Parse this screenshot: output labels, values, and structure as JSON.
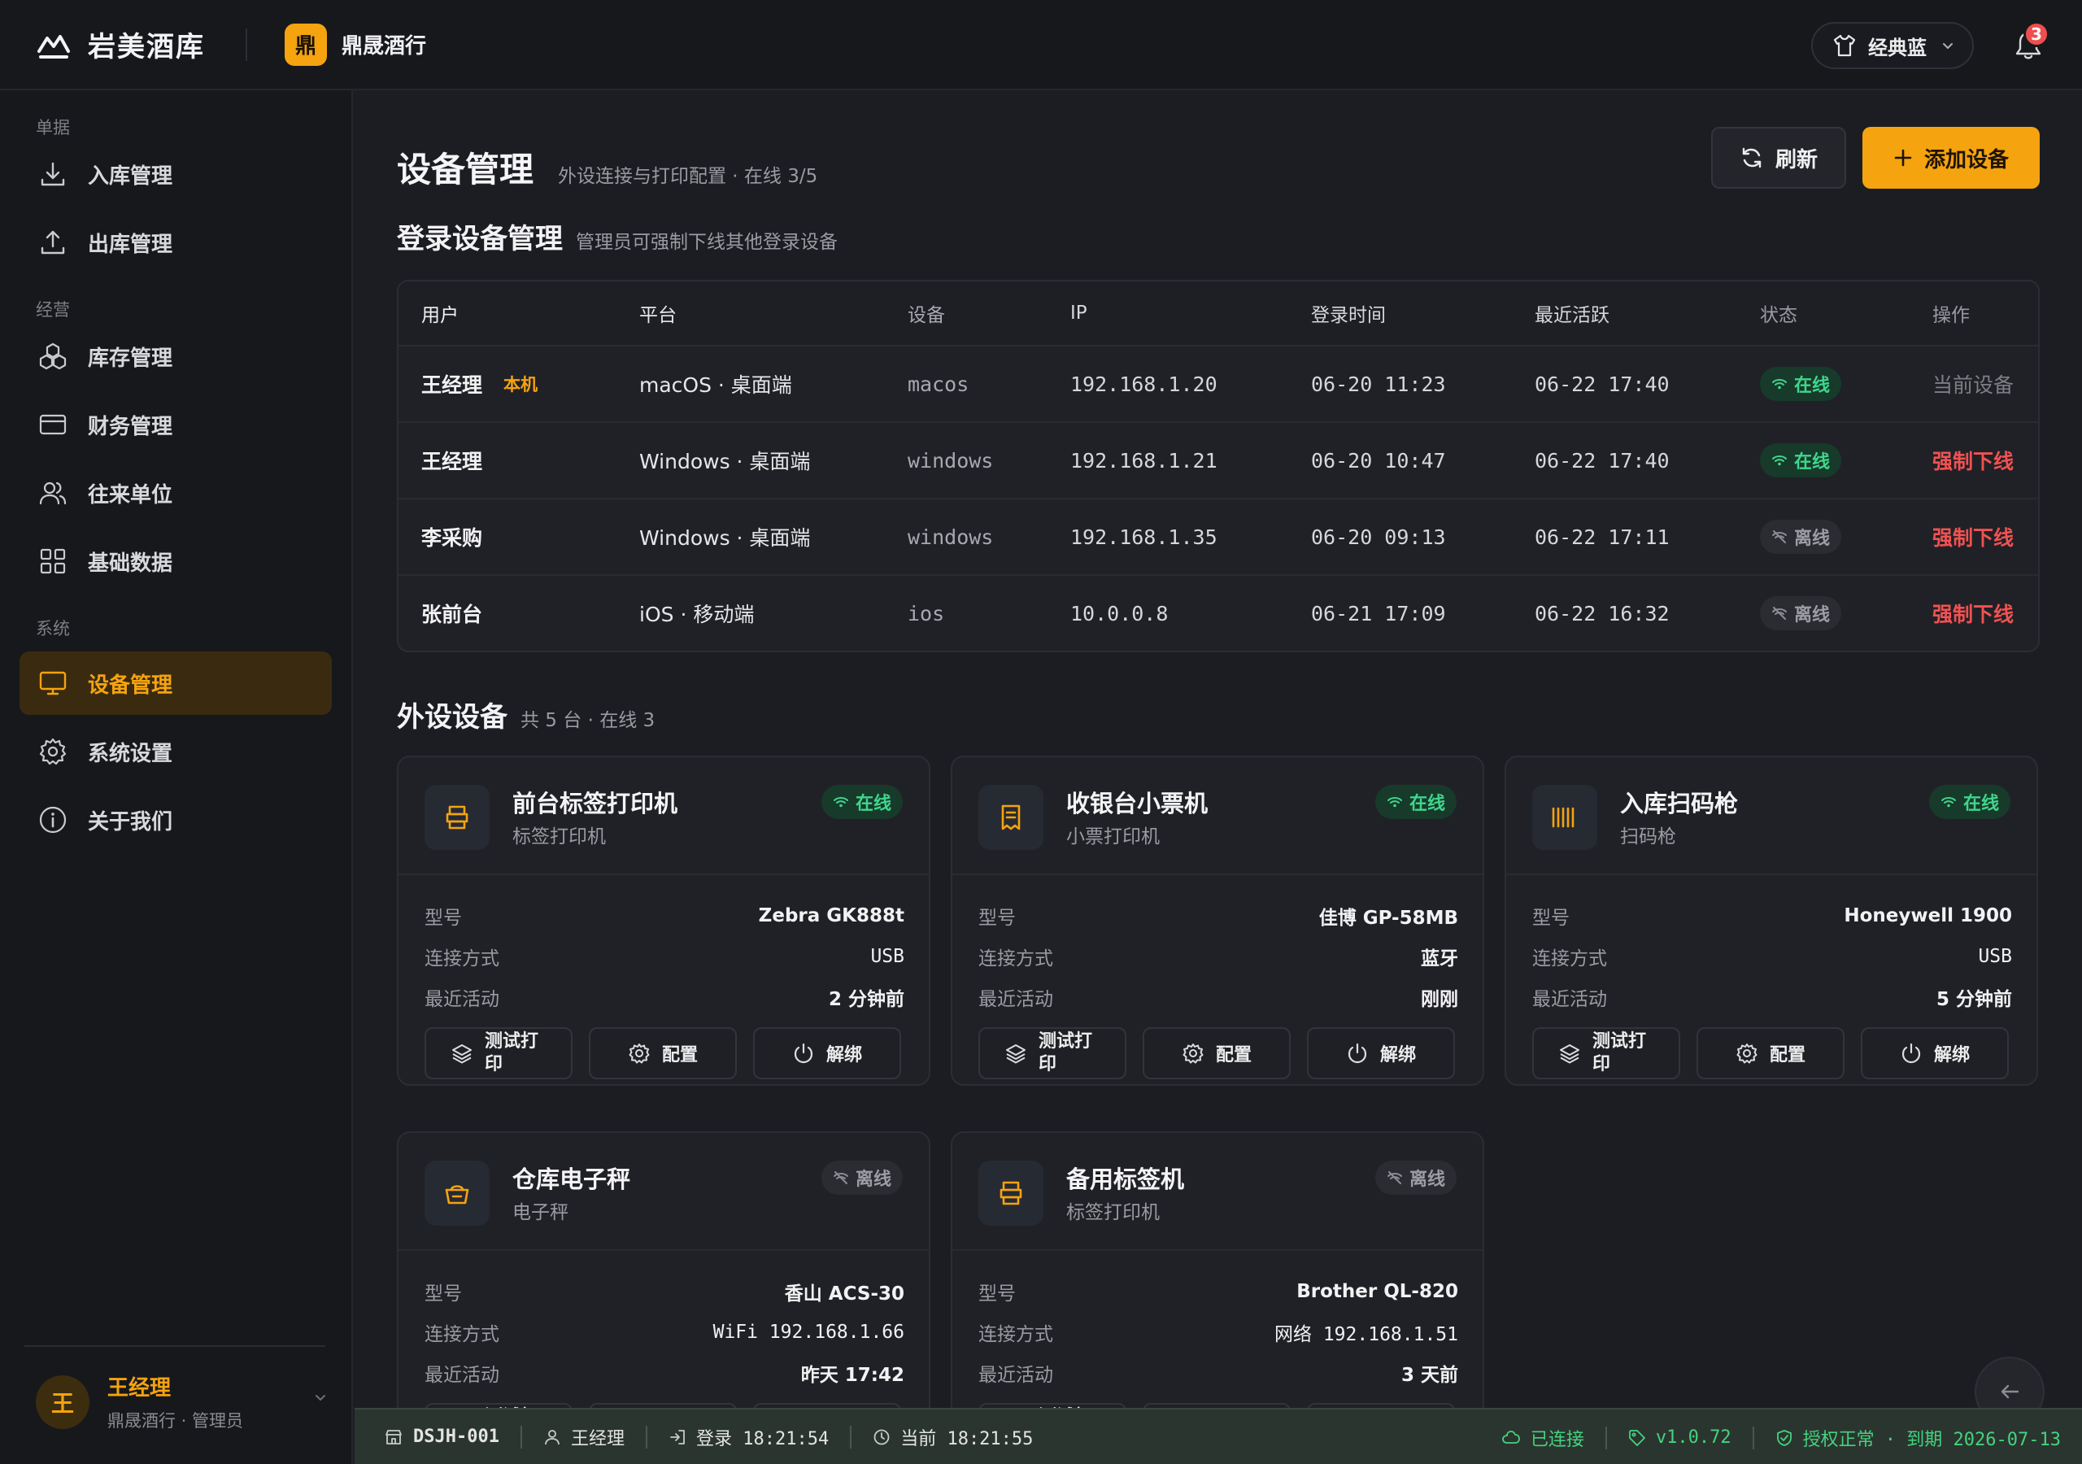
{
  "app": {
    "name": "岩美酒库",
    "shop_badge": "鼎",
    "shop_name": "鼎晟酒行"
  },
  "header": {
    "theme_label": "经典蓝",
    "notification_count": "3"
  },
  "sidebar": {
    "groups": [
      {
        "label": "单据",
        "items": [
          {
            "label": "入库管理",
            "icon": "download-icon"
          },
          {
            "label": "出库管理",
            "icon": "upload-icon"
          }
        ]
      },
      {
        "label": "经营",
        "items": [
          {
            "label": "库存管理",
            "icon": "boxes-icon"
          },
          {
            "label": "财务管理",
            "icon": "card-icon"
          },
          {
            "label": "往来单位",
            "icon": "users-icon"
          },
          {
            "label": "基础数据",
            "icon": "grid-icon"
          }
        ]
      },
      {
        "label": "系统",
        "items": [
          {
            "label": "设备管理",
            "icon": "monitor-icon",
            "active": true
          },
          {
            "label": "系统设置",
            "icon": "gear-icon"
          },
          {
            "label": "关于我们",
            "icon": "info-icon"
          }
        ]
      }
    ],
    "user": {
      "avatar": "王",
      "name": "王经理",
      "role": "鼎晟酒行 · 管理员"
    }
  },
  "page": {
    "title": "设备管理",
    "subtitle": "外设连接与打印配置 · 在线 3/5",
    "refresh_label": "刷新",
    "add_label": "添加设备"
  },
  "sessions": {
    "title": "登录设备管理",
    "subtitle": "管理员可强制下线其他登录设备",
    "columns": [
      "用户",
      "平台",
      "设备",
      "IP",
      "登录时间",
      "最近活跃",
      "状态",
      "操作"
    ],
    "rows": [
      {
        "user": "王经理",
        "tag": "本机",
        "platform": "macOS · 桌面端",
        "device": "macos",
        "ip": "192.168.1.20",
        "login": "06-20 11:23",
        "last": "06-22 17:40",
        "status": "在线",
        "online": true,
        "action": "当前设备"
      },
      {
        "user": "王经理",
        "tag": "",
        "platform": "Windows · 桌面端",
        "device": "windows",
        "ip": "192.168.1.21",
        "login": "06-20 10:47",
        "last": "06-22 17:40",
        "status": "在线",
        "online": true,
        "action": "强制下线"
      },
      {
        "user": "李采购",
        "tag": "",
        "platform": "Windows · 桌面端",
        "device": "windows",
        "ip": "192.168.1.35",
        "login": "06-20 09:13",
        "last": "06-22 17:11",
        "status": "离线",
        "online": false,
        "action": "强制下线"
      },
      {
        "user": "张前台",
        "tag": "",
        "platform": "iOS · 移动端",
        "device": "ios",
        "ip": "10.0.0.8",
        "login": "06-21 17:09",
        "last": "06-22 16:32",
        "status": "离线",
        "online": false,
        "action": "强制下线"
      }
    ]
  },
  "peripherals": {
    "title": "外设设备",
    "subtitle": "共 5 台 · 在线 3",
    "labels": {
      "model": "型号",
      "connection": "连接方式",
      "last_active": "最近活动"
    },
    "buttons": {
      "test": "测试打印",
      "config": "配置",
      "unbind": "解绑"
    },
    "devices": [
      {
        "name": "前台标签打印机",
        "type": "标签打印机",
        "icon": "label-printer-icon",
        "status": "在线",
        "online": true,
        "model": "Zebra GK888t",
        "connection": "USB",
        "last_active": "2 分钟前"
      },
      {
        "name": "收银台小票机",
        "type": "小票打印机",
        "icon": "receipt-icon",
        "status": "在线",
        "online": true,
        "model": "佳博 GP-58MB",
        "connection": "蓝牙",
        "last_active": "刚刚"
      },
      {
        "name": "入库扫码枪",
        "type": "扫码枪",
        "icon": "barcode-icon",
        "status": "在线",
        "online": true,
        "model": "Honeywell 1900",
        "connection": "USB",
        "last_active": "5 分钟前"
      },
      {
        "name": "仓库电子秤",
        "type": "电子秤",
        "icon": "scale-icon",
        "status": "离线",
        "online": false,
        "model": "香山 ACS-30",
        "connection": "WiFi 192.168.1.66",
        "last_active": "昨天 17:42"
      },
      {
        "name": "备用标签机",
        "type": "标签打印机",
        "icon": "label-printer-icon",
        "status": "离线",
        "online": false,
        "model": "Brother QL-820",
        "connection": "网络 192.168.1.51",
        "last_active": "3 天前"
      }
    ]
  },
  "statusbar": {
    "terminal": "DSJH-001",
    "user": "王经理",
    "login": "登录 18:21:54",
    "now": "当前 18:21:55",
    "connection": "已连接",
    "version": "v1.0.72",
    "license": "授权正常 · 到期 2026-07-13"
  },
  "colors": {
    "accent": "#f5a30f",
    "online": "#3fd68c",
    "danger": "#f05252",
    "statusbar": "#2b352f"
  }
}
